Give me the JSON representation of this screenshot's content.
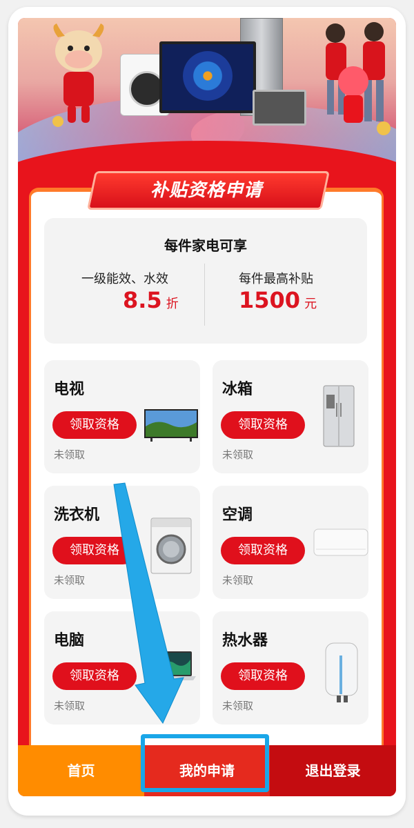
{
  "banner_title": "补贴资格申请",
  "summary": {
    "heading": "每件家电可享",
    "left_label": "一级能效、水效",
    "left_value": "8.5",
    "left_unit": "折",
    "right_label": "每件最高补贴",
    "right_value": "1500",
    "right_unit": "元"
  },
  "categories": [
    {
      "name": "电视",
      "button": "领取资格",
      "status": "未领取",
      "icon": "tv-icon"
    },
    {
      "name": "冰箱",
      "button": "领取资格",
      "status": "未领取",
      "icon": "fridge-icon"
    },
    {
      "name": "洗衣机",
      "button": "领取资格",
      "status": "未领取",
      "icon": "washing-machine-icon"
    },
    {
      "name": "空调",
      "button": "领取资格",
      "status": "未领取",
      "icon": "air-conditioner-icon"
    },
    {
      "name": "电脑",
      "button": "领取资格",
      "status": "未领取",
      "icon": "laptop-icon"
    },
    {
      "name": "热水器",
      "button": "领取资格",
      "status": "未领取",
      "icon": "water-heater-icon"
    }
  ],
  "nav": {
    "home": "首页",
    "my_apply": "我的申请",
    "logout": "退出登录",
    "selected": "我的申请"
  },
  "colors": {
    "brand_red": "#e0101c",
    "home_orange": "#ff8c00",
    "logout_dark_red": "#c40c10",
    "highlight_blue": "#1aa6e8"
  }
}
